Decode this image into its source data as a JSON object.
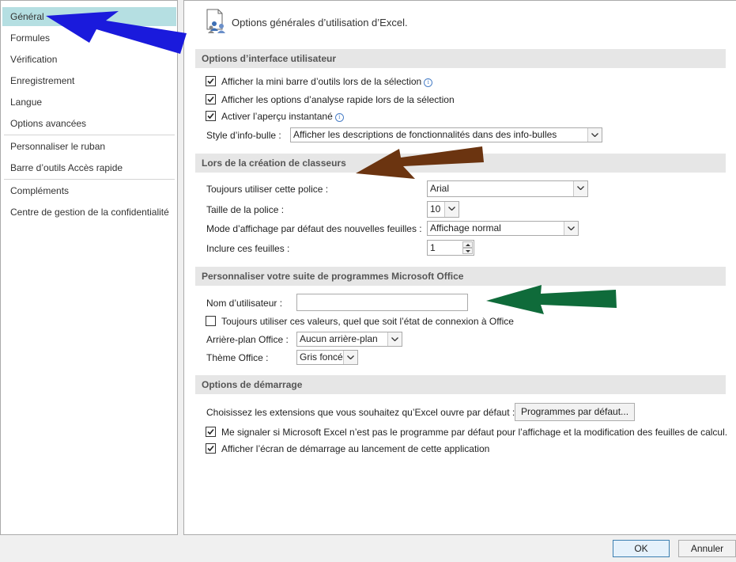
{
  "sidebar": {
    "items": [
      {
        "label": "Général"
      },
      {
        "label": "Formules"
      },
      {
        "label": "Vérification"
      },
      {
        "label": "Enregistrement"
      },
      {
        "label": "Langue"
      },
      {
        "label": "Options avancées"
      },
      {
        "label": "Personnaliser le ruban"
      },
      {
        "label": "Barre d’outils Accès rapide"
      },
      {
        "label": "Compléments"
      },
      {
        "label": "Centre de gestion de la confidentialité"
      }
    ],
    "selected_index": 0,
    "selected_color": "#b5dfe2"
  },
  "header": {
    "title": "Options générales d’utilisation d’Excel.",
    "icon": "general-options-icon"
  },
  "ui_options": {
    "heading": "Options d’interface utilisateur",
    "mini_toolbar": {
      "label": "Afficher la mini barre d’outils lors de la sélection",
      "checked": true
    },
    "quick_analysis": {
      "label": "Afficher les options d’analyse rapide lors de la sélection",
      "checked": true
    },
    "live_preview": {
      "label": "Activer l’aperçu instantané",
      "checked": true
    },
    "tooltip_style": {
      "label": "Style d’info-bulle :",
      "value": "Afficher les descriptions de fonctionnalités dans des info-bulles"
    }
  },
  "new_workbooks": {
    "heading": "Lors de la création de classeurs",
    "font": {
      "label": "Toujours utiliser cette police :",
      "value": "Arial"
    },
    "font_size": {
      "label": "Taille de la police :",
      "value": "10"
    },
    "view_mode": {
      "label": "Mode d’affichage par défaut des nouvelles feuilles :",
      "value": "Affichage normal"
    },
    "sheet_count": {
      "label": "Inclure ces feuilles :",
      "value": "1"
    }
  },
  "personalize": {
    "heading": "Personnaliser votre suite de programmes Microsoft Office",
    "username": {
      "label": "Nom d’utilisateur :",
      "value": ""
    },
    "always_use": {
      "label": "Toujours utiliser ces valeurs, quel que soit l’état de connexion à Office",
      "checked": false
    },
    "background": {
      "label": "Arrière-plan Office :",
      "value": "Aucun arrière-plan"
    },
    "theme": {
      "label": "Thème Office :",
      "value": "Gris foncé"
    }
  },
  "startup": {
    "heading": "Options de démarrage",
    "extensions_label": "Choisissez les extensions que vous souhaitez qu’Excel ouvre par défaut :",
    "default_programs_button": "Programmes par défaut...",
    "notify_default": {
      "label": "Me signaler si Microsoft Excel n’est pas le programme par défaut pour l’affichage et la modification des feuilles de calcul.",
      "checked": true
    },
    "show_start_screen": {
      "label": "Afficher l’écran de démarrage au lancement de cette application",
      "checked": true
    }
  },
  "footer": {
    "ok": "OK",
    "cancel": "Annuler"
  },
  "annotation_colors": {
    "blue": "#1a1adc",
    "brown": "#6b3410",
    "green": "#0f6b3a"
  }
}
